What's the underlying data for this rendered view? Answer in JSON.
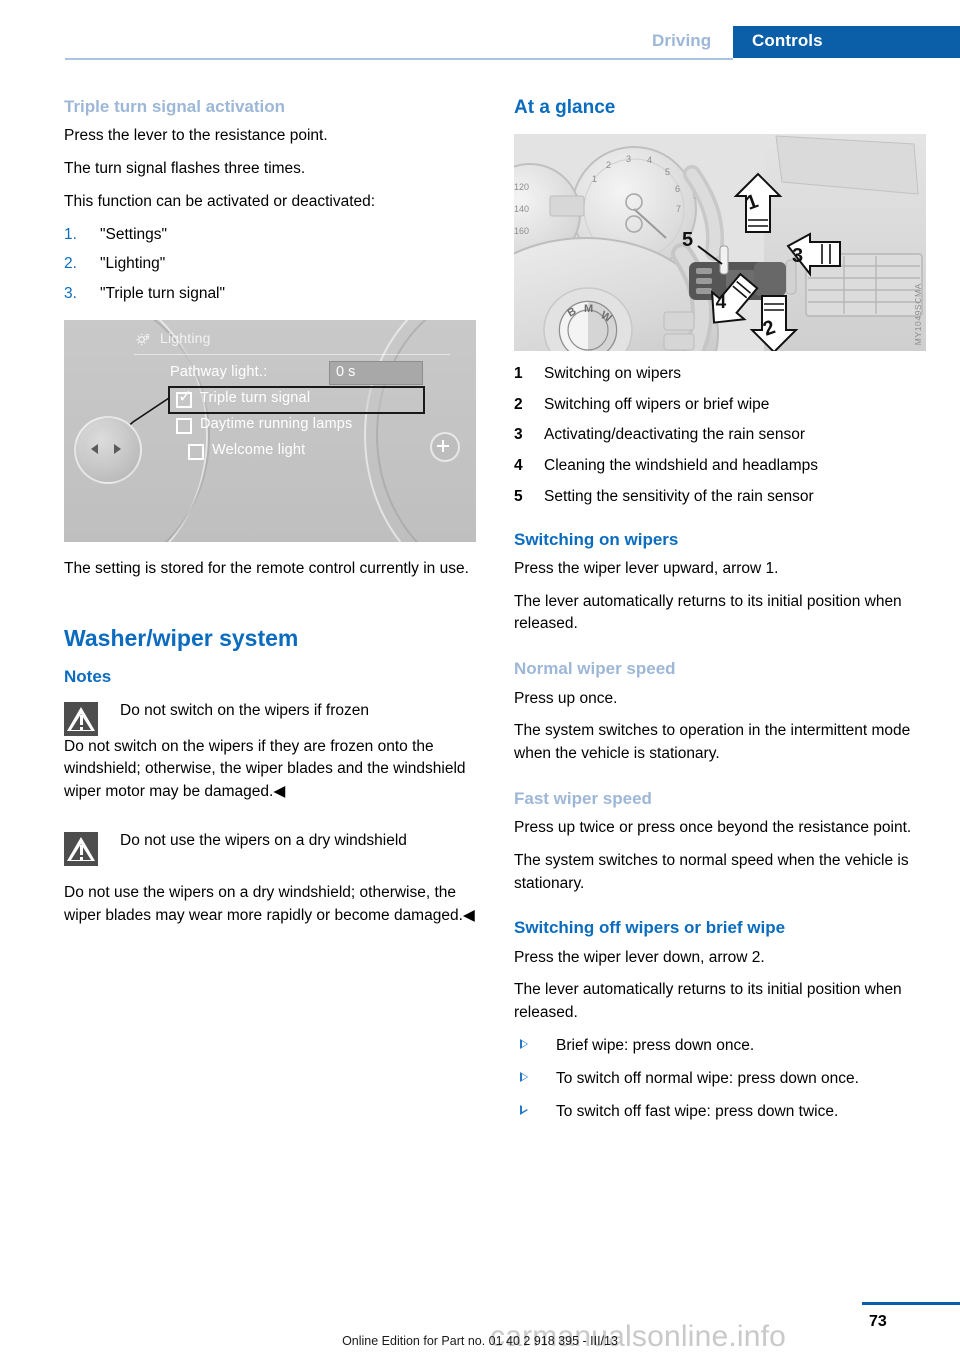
{
  "header": {
    "tab_inactive": "Driving",
    "tab_active": "Controls",
    "accent_blue": "#0b5ea8",
    "muted_blue": "#9db7d8"
  },
  "left_column": {
    "heading_triple": "Triple turn signal activation",
    "paragraphs": [
      "Press the lever to the resistance point.",
      "The turn signal flashes three times.",
      "This function can be activated or deactivated:"
    ],
    "steps": [
      {
        "num": "1.",
        "label": "\"Settings\""
      },
      {
        "num": "2.",
        "label": "\"Lighting\""
      },
      {
        "num": "3.",
        "label": "\"Triple turn signal\""
      }
    ],
    "idrive_screen": {
      "menu_title": "Lighting",
      "gear_icon": "gear-icon",
      "rows": [
        {
          "label": "Pathway light.:",
          "value": "0 s",
          "type": "value"
        },
        {
          "label": "Triple turn signal",
          "checked": true,
          "selected": true,
          "type": "checkbox"
        },
        {
          "label": "Daytime running lamps",
          "checked": false,
          "selected": false,
          "type": "checkbox"
        },
        {
          "label": "Welcome light",
          "checked": false,
          "selected": false,
          "type": "checkbox"
        }
      ],
      "controller_icon": "idrive-controller-knob",
      "plus_icon": "plus-button-icon"
    },
    "after_figure": "The setting is stored for the remote control currently in use.",
    "heading_washer": "Washer/wiper system",
    "heading_notes": "Notes",
    "warning_1": {
      "icon": "warning-triangle-icon",
      "title": "Do not switch on the wipers if frozen",
      "body": "Do not switch on the wipers if they are frozen onto the windshield; otherwise, the wiper blades and the windshield wiper motor may be damaged.◀"
    },
    "warning_2": {
      "icon": "warning-triangle-icon",
      "title": "Do not use the wipers on a dry windshield",
      "body": "Do not use the wipers on a dry windshield; otherwise, the wiper blades may wear more rapidly or become damaged.◀"
    }
  },
  "right_column": {
    "heading_glance": "At a glance",
    "figure": {
      "alt": "BMW steering wheel and instrument cluster with wiper lever callouts",
      "image_code": "MY1049SCMA",
      "callouts": [
        "1",
        "2",
        "3",
        "4",
        "5"
      ]
    },
    "legend": [
      {
        "num": "1",
        "label": "Switching on wipers"
      },
      {
        "num": "2",
        "label": "Switching off wipers or brief wipe"
      },
      {
        "num": "3",
        "label": "Activating/deactivating the rain sensor"
      },
      {
        "num": "4",
        "label": "Cleaning the windshield and headlamps"
      },
      {
        "num": "5",
        "label": "Setting the sensitivity of the rain sensor"
      }
    ],
    "heading_switch_on": "Switching on wipers",
    "switch_on_paras": [
      "Press the wiper lever upward, arrow 1.",
      "The lever automatically returns to its initial position when released."
    ],
    "heading_normal": "Normal wiper speed",
    "normal_paras": [
      "Press up once.",
      "The system switches to operation in the intermittent mode when the vehicle is stationary."
    ],
    "heading_fast": "Fast wiper speed",
    "fast_paras": [
      "Press up twice or press once beyond the resistance point.",
      "The system switches to normal speed when the vehicle is stationary."
    ],
    "heading_switch_off": "Switching off wipers or brief wipe",
    "switch_off_paras": [
      "Press the wiper lever down, arrow 2.",
      "The lever automatically returns to its initial position when released."
    ],
    "bullets": [
      "Brief wipe: press down once.",
      "To switch off normal wipe: press down once.",
      "To switch off fast wipe: press down twice."
    ]
  },
  "footer": {
    "edition_text": "Online Edition for Part no. 01 40 2 918 395 - III/13",
    "page_number": "73",
    "watermark": "carmanualsonline.info"
  }
}
